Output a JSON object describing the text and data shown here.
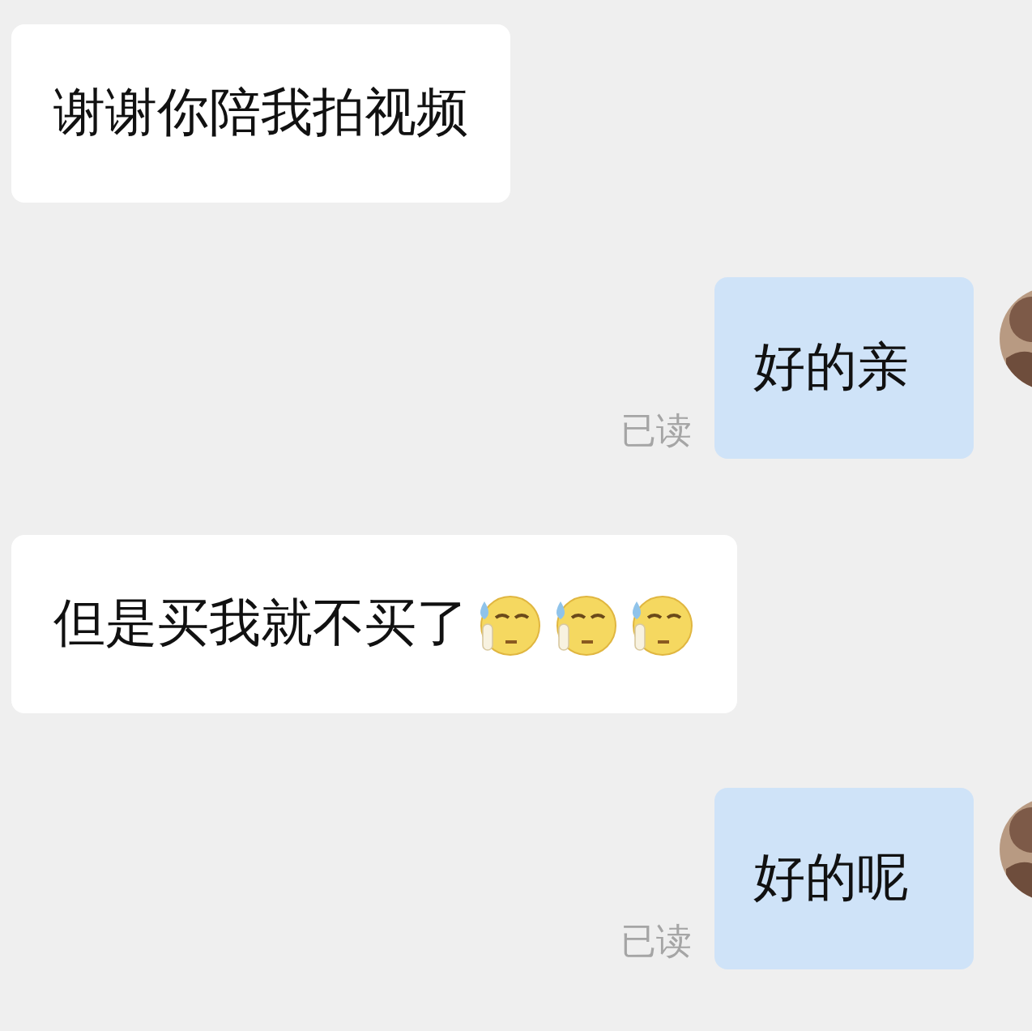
{
  "messages": [
    {
      "kind": "incoming",
      "text": "谢谢你陪我拍视频"
    },
    {
      "kind": "outgoing",
      "text": "好的亲",
      "read_label": "已读"
    },
    {
      "kind": "incoming",
      "text": "但是买我就不买了",
      "emojis": [
        {
          "kind": "sweat"
        },
        {
          "kind": "sweat"
        },
        {
          "kind": "sweat"
        }
      ]
    },
    {
      "kind": "outgoing",
      "text": "好的呢",
      "read_label": "已读"
    }
  ]
}
